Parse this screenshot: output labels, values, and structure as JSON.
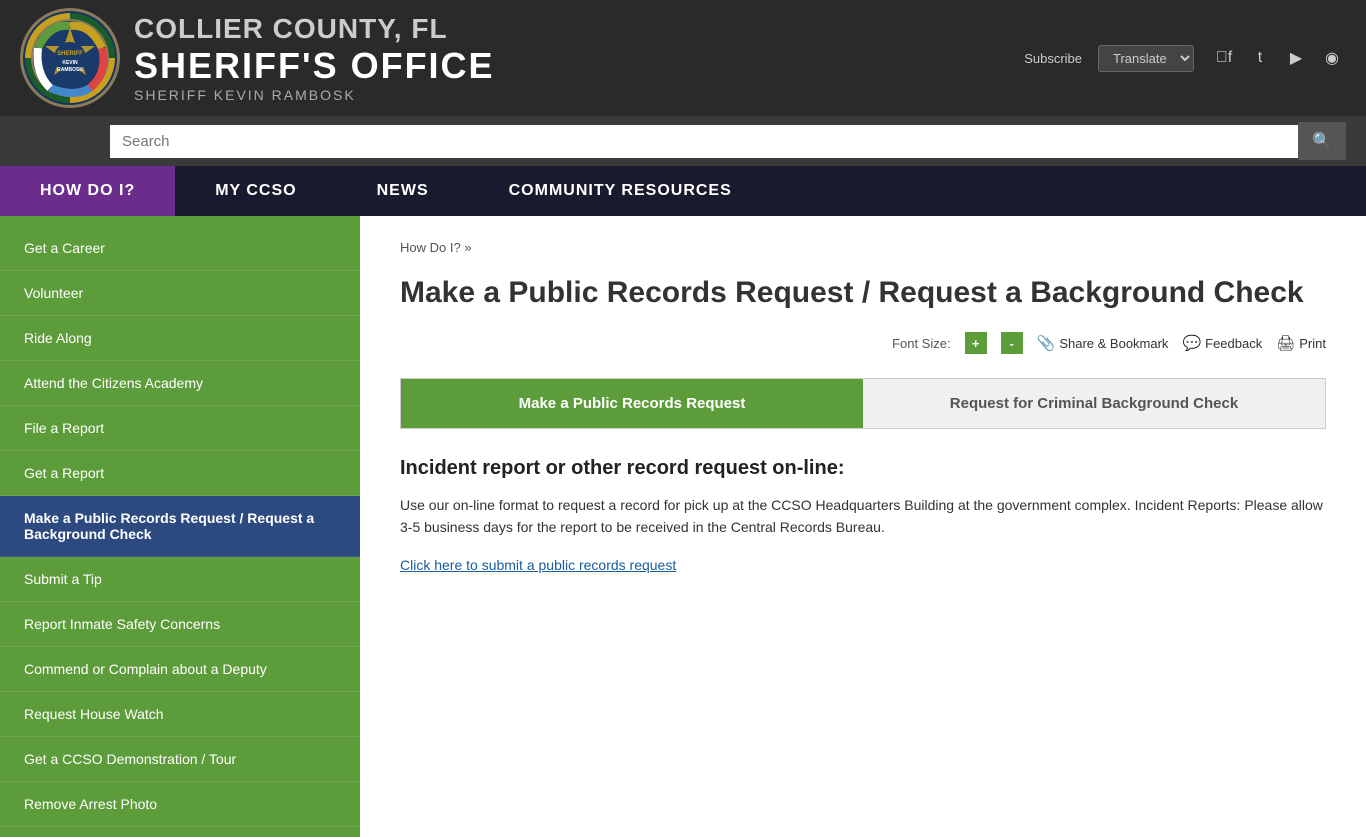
{
  "header": {
    "county": "COLLIER COUNTY, FL",
    "office": "SHERIFF'S OFFICE",
    "sheriff": "SHERIFF KEVIN RAMBOSK",
    "subscribe": "Subscribe",
    "translate_placeholder": "Translate",
    "search_placeholder": "Search"
  },
  "nav": {
    "items": [
      {
        "label": "HOW DO I?",
        "active": true
      },
      {
        "label": "MY CCSO",
        "active": false
      },
      {
        "label": "NEWS",
        "active": false
      },
      {
        "label": "COMMUNITY RESOURCES",
        "active": false
      }
    ]
  },
  "sidebar": {
    "items": [
      {
        "label": "Get a Career",
        "active": false
      },
      {
        "label": "Volunteer",
        "active": false
      },
      {
        "label": "Ride Along",
        "active": false
      },
      {
        "label": "Attend the Citizens Academy",
        "active": false
      },
      {
        "label": "File a Report",
        "active": false
      },
      {
        "label": "Get a Report",
        "active": false
      },
      {
        "label": "Make a Public Records Request / Request a Background Check",
        "active": true
      },
      {
        "label": "Submit a Tip",
        "active": false
      },
      {
        "label": "Report Inmate Safety Concerns",
        "active": false
      },
      {
        "label": "Commend or Complain about a Deputy",
        "active": false
      },
      {
        "label": "Request House Watch",
        "active": false
      },
      {
        "label": "Get a CCSO Demonstration / Tour",
        "active": false
      },
      {
        "label": "Remove Arrest Photo",
        "active": false
      }
    ]
  },
  "breadcrumb": {
    "text": "How Do I?",
    "separator": "»"
  },
  "page": {
    "title": "Make a Public Records Request / Request a Background Check",
    "font_size_label": "Font Size:",
    "increase_font": "+",
    "decrease_font": "-",
    "share_bookmark": "Share & Bookmark",
    "feedback": "Feedback",
    "print": "Print"
  },
  "tabs": [
    {
      "label": "Make a Public Records Request",
      "active": true
    },
    {
      "label": "Request for Criminal Background Check",
      "active": false
    }
  ],
  "content": {
    "section_title": "Incident report or other record request on-line:",
    "section_body": "Use our on-line format to request a record for pick up at the CCSO Headquarters Building at the government complex. Incident Reports: Please allow 3-5 business days for the report to be received in the Central Records Bureau.",
    "link_text": "Click here to submit a public records request"
  }
}
